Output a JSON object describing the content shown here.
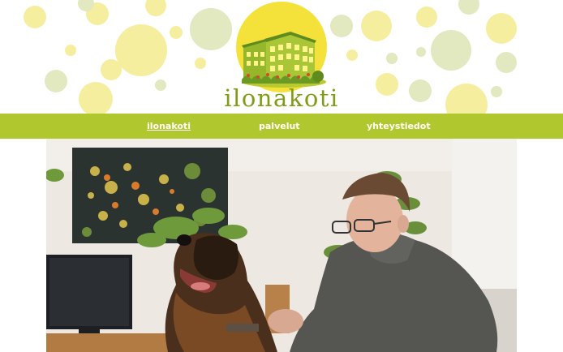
{
  "site": {
    "brand_name": "ilonakoti"
  },
  "nav": {
    "items": [
      {
        "label": "ilonakoti",
        "active": true
      },
      {
        "label": "palvelut",
        "active": false
      },
      {
        "label": "yhteystiedot",
        "active": false
      }
    ]
  },
  "colors": {
    "nav_background": "#b1c72e",
    "bubble_yellow": "#f5ea97",
    "bubble_green": "#dde5b8",
    "logo_circle": "#f4e23a",
    "brand_text": "#7e9c16"
  },
  "icons": {
    "logo": "building-icon"
  }
}
